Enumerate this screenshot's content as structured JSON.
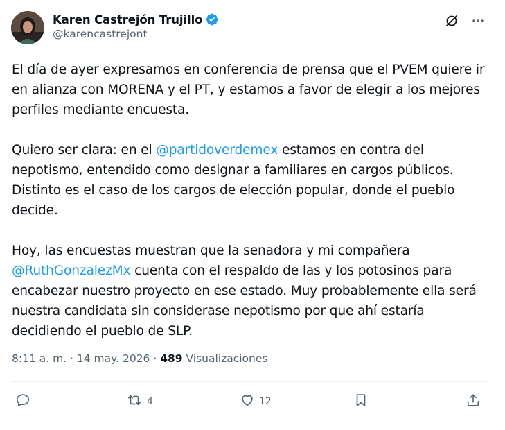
{
  "tweet": {
    "author": {
      "name": "Karen Castrejón Trujillo",
      "handle": "@karencastrejont",
      "verified": true
    },
    "paragraphs": [
      [
        {
          "text": "El día de ayer expresamos en conferencia de prensa que el PVEM quiere ir en alianza con MORENA y el PT, y estamos a favor de elegir a los mejores perfiles mediante encuesta.",
          "mention": false
        }
      ],
      [
        {
          "text": "Quiero ser clara: en el ",
          "mention": false
        },
        {
          "text": "@partidoverdemex",
          "mention": true
        },
        {
          "text": " estamos en contra del nepotismo, entendido como designar a familiares en cargos públicos. Distinto es el caso de los cargos de elección popular, donde el pueblo decide.",
          "mention": false
        }
      ],
      [
        {
          "text": "Hoy, las encuestas muestran que la senadora y mi compañera ",
          "mention": false
        },
        {
          "text": "@RuthGonzalezMx",
          "mention": true
        },
        {
          "text": " cuenta con el respaldo de las y los potosinos para encabezar nuestro proyecto en ese estado. Muy probablemente ella será nuestra candidata sin considerase nepotismo por que ahí estaría decidiendo el pueblo de SLP.",
          "mention": false
        }
      ]
    ],
    "meta": {
      "time": "8:11 a. m.",
      "separator1": " · ",
      "date": "14 may. 2026",
      "separator2": " · ",
      "views_count": "489",
      "views_label": " Visualizaciones"
    },
    "actions": {
      "replies": "",
      "reposts": "4",
      "likes": "12",
      "bookmarks": ""
    }
  },
  "icons": {
    "verified": "verified-badge-icon",
    "grok": "grok-icon",
    "more": "more-icon",
    "reply": "reply-icon",
    "repost": "repost-icon",
    "like": "like-icon",
    "bookmark": "bookmark-icon",
    "share": "share-icon"
  },
  "colors": {
    "accent": "#1d9bf0",
    "text": "#0f1419",
    "muted": "#536471"
  }
}
